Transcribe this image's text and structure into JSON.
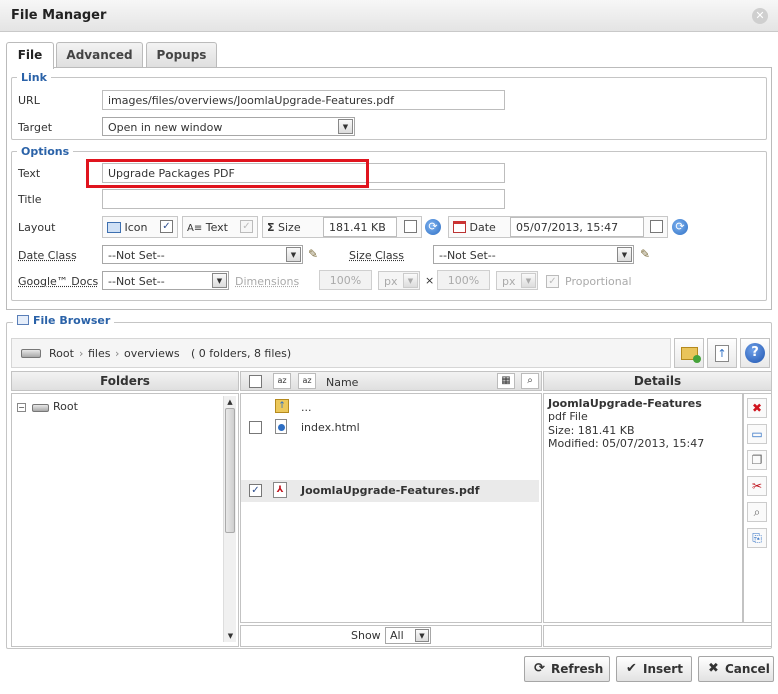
{
  "window": {
    "title": "File Manager"
  },
  "tabs": [
    {
      "label": "File",
      "active": true
    },
    {
      "label": "Advanced",
      "active": false
    },
    {
      "label": "Popups",
      "active": false
    }
  ],
  "link": {
    "legend": "Link",
    "url_label": "URL",
    "url_value": "images/files/overviews/JoomlaUpgrade-Features.pdf",
    "target_label": "Target",
    "target_value": "Open in new window"
  },
  "options": {
    "legend": "Options",
    "text_label": "Text",
    "text_value": "Upgrade Packages PDF",
    "title_label": "Title",
    "title_value": "",
    "layout_label": "Layout",
    "layout_icon": "Icon",
    "layout_text": "Text",
    "layout_size": "Size",
    "size_value": "181.41 KB",
    "layout_date": "Date",
    "date_value": "05/07/2013, 15:47",
    "date_class_label": "Date Class",
    "date_class_value": "--Not Set--",
    "size_class_label": "Size Class",
    "size_class_value": "--Not Set--",
    "google_label": "Google™ Docs",
    "google_value": "--Not Set--",
    "dimensions_label": "Dimensions",
    "width_value": "100%",
    "width_unit": "px",
    "times": "×",
    "height_value": "100%",
    "height_unit": "px",
    "proportional_label": "Proportional"
  },
  "browser": {
    "legend": "File Browser",
    "path_root": "Root",
    "path_sep1": "›",
    "path_files": "files",
    "path_sep2": "›",
    "path_overviews": "overviews",
    "path_count": "( 0 folders, 8 files)",
    "folders_header": "Folders",
    "name_header": "Name",
    "details_header": "Details",
    "tree_root": "Root",
    "files": [
      {
        "name": "...",
        "selected": false
      },
      {
        "name": "index.html",
        "selected": false
      },
      {
        "name": "JoomlaUpgrade-Features.pdf",
        "selected": true
      }
    ],
    "details": {
      "name": "JoomlaUpgrade-Features",
      "type": "pdf File",
      "size": "Size: 181.41 KB",
      "modified": "Modified: 05/07/2013, 15:47"
    },
    "show_label": "Show",
    "show_value": "All"
  },
  "buttons": {
    "refresh": "Refresh",
    "insert": "Insert",
    "cancel": "Cancel"
  },
  "colors": {
    "accent": "#2a62a8",
    "highlight": "#e0141e"
  }
}
